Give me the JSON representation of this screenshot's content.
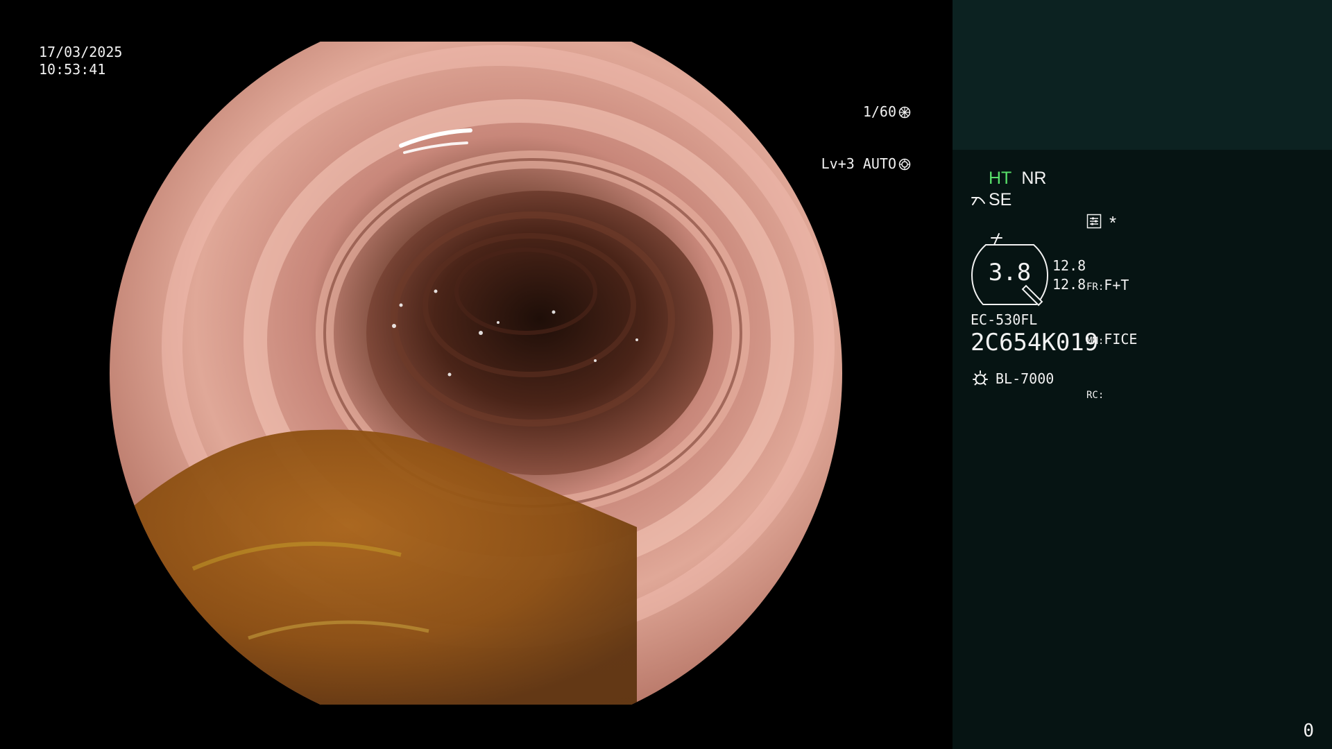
{
  "video": {
    "date": "17/03/2025",
    "time": "10:53:41",
    "shutter": "1/60",
    "level_mode": "Lv+3 AUTO"
  },
  "panel": {
    "mode_ht": "HT",
    "mode_nr": "NR",
    "se_label": "SE",
    "asterisk": "*",
    "zoom": "3.8",
    "param_val_1": "12.8",
    "param_val_2": "12.8",
    "fr_label": "FR:",
    "fr_value": "F+T",
    "mm_label": "MM:",
    "mm_value": "FICE",
    "rc_label": "RC:",
    "scope_model": "EC-530FL",
    "serial": "2C654K019",
    "light_source": "BL-7000",
    "counter": "0"
  },
  "colors": {
    "panel_bg": "#061413",
    "panel_header_bg": "#0c2221",
    "ht_green": "#58e06a",
    "osd_text": "#f2f2f2"
  },
  "icons": [
    "shutter-icon",
    "auto-iris-icon",
    "enhance-icon",
    "function-icon",
    "settings-icon",
    "zoom-badge-icon",
    "light-source-icon"
  ]
}
